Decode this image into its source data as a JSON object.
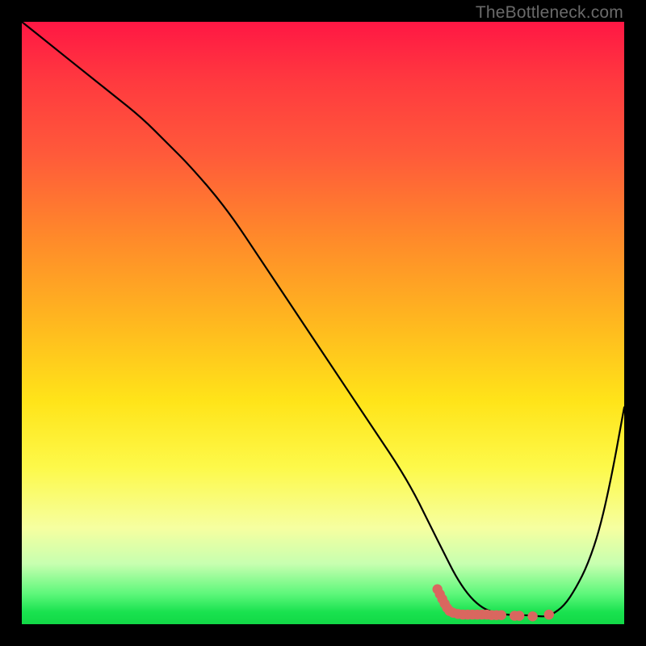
{
  "watermark": "TheBottleneck.com",
  "chart_data": {
    "type": "line",
    "title": "",
    "xlabel": "",
    "ylabel": "",
    "xlim": [
      0,
      100
    ],
    "ylim": [
      0,
      100
    ],
    "grid": false,
    "legend": false,
    "series": [
      {
        "name": "curve",
        "x": [
          0,
          5,
          10,
          15,
          20,
          24,
          28,
          34,
          40,
          46,
          52,
          58,
          64,
          68,
          70,
          72,
          74,
          76,
          78,
          80,
          82,
          84,
          86,
          87,
          88,
          90,
          92,
          94,
          96,
          98,
          100
        ],
        "y": [
          100,
          96,
          92,
          88,
          84,
          80,
          76,
          69,
          60,
          51,
          42,
          33,
          24,
          16,
          12,
          8,
          5,
          3,
          2,
          1.6,
          1.5,
          1.5,
          1.3,
          1.3,
          1.6,
          3,
          6,
          10,
          16,
          25,
          36
        ]
      }
    ],
    "markers": {
      "name": "bottleneck-markers",
      "color": "#d9675f",
      "points": [
        {
          "x": 69.0,
          "y": 5.8
        },
        {
          "x": 69.4,
          "y": 5.0
        },
        {
          "x": 69.8,
          "y": 4.2
        },
        {
          "x": 70.2,
          "y": 3.4
        },
        {
          "x": 70.6,
          "y": 2.7
        },
        {
          "x": 71.0,
          "y": 2.2
        },
        {
          "x": 71.6,
          "y": 1.9
        },
        {
          "x": 72.4,
          "y": 1.7
        },
        {
          "x": 73.2,
          "y": 1.6
        },
        {
          "x": 74.0,
          "y": 1.6
        },
        {
          "x": 74.8,
          "y": 1.6
        },
        {
          "x": 75.6,
          "y": 1.6
        },
        {
          "x": 76.4,
          "y": 1.6
        },
        {
          "x": 77.2,
          "y": 1.6
        },
        {
          "x": 78.0,
          "y": 1.5
        },
        {
          "x": 78.8,
          "y": 1.5
        },
        {
          "x": 79.6,
          "y": 1.5
        },
        {
          "x": 81.8,
          "y": 1.4
        },
        {
          "x": 82.6,
          "y": 1.4
        },
        {
          "x": 84.8,
          "y": 1.3
        },
        {
          "x": 87.5,
          "y": 1.6
        }
      ]
    }
  }
}
